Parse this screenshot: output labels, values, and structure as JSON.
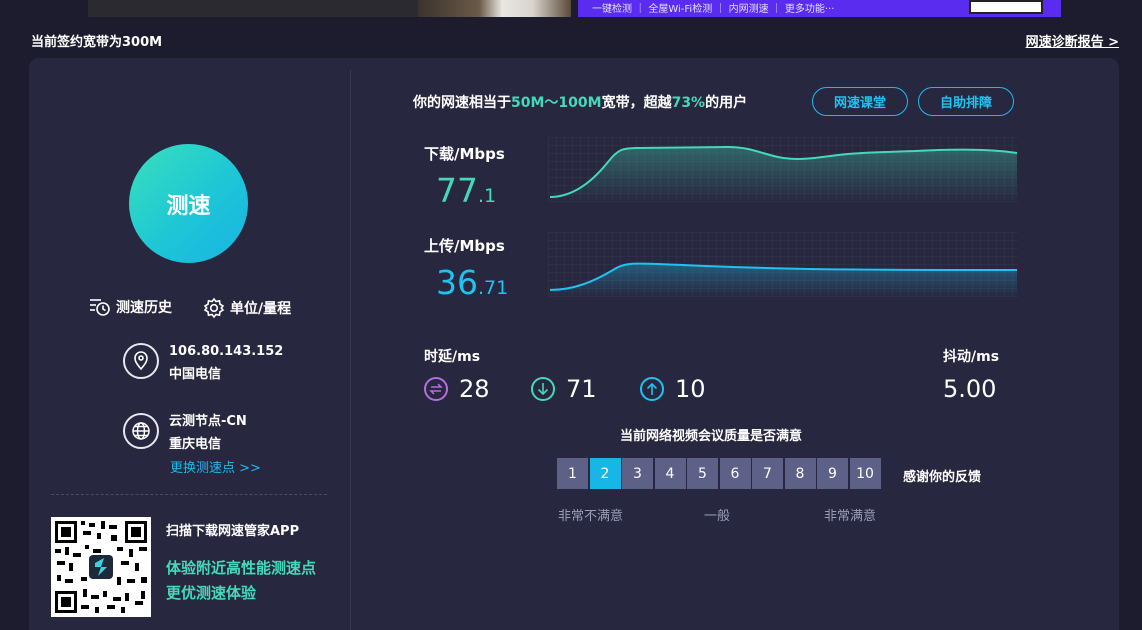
{
  "plan_text": "当前签约宽带为300M",
  "report_link": "网速诊断报告 >",
  "banner_right_text": "一键检测 ｜ 全屋Wi-Fi检测 ｜ 内网测速 ｜ 更多功能···",
  "start_button": "测速",
  "links": {
    "history": "测速历史",
    "units": "单位/量程"
  },
  "client": {
    "ip": "106.80.143.152",
    "isp": "中国电信"
  },
  "server": {
    "name": "云测节点-CN",
    "isp": "重庆电信",
    "change": "更换测速点 >>"
  },
  "app": {
    "title": "扫描下载网速管家APP",
    "line1": "体验附近高性能测速点",
    "line2": "更优测速体验"
  },
  "summary": {
    "prefix": "你的网速相当于",
    "band": "50M～100M",
    "mid": "宽带，超越",
    "percent": "73%",
    "suffix": "的用户"
  },
  "buttons": {
    "classroom": "网速课堂",
    "troubleshoot": "自助排障"
  },
  "download": {
    "label": "下载/Mbps",
    "int": "77",
    "dec": ".1",
    "color": "#44d9b8"
  },
  "upload": {
    "label": "上传/Mbps",
    "int": "36",
    "dec": ".71",
    "color": "#1fc3f0"
  },
  "latency": {
    "label": "时延/ms",
    "idle": "28",
    "down": "71",
    "up": "10",
    "colors": [
      "#b46fe0",
      "#44d9b8",
      "#1fc3f0"
    ]
  },
  "jitter": {
    "label": "抖动/ms",
    "value": "5.00"
  },
  "survey": {
    "question": "当前网络视频会议质量是否满意",
    "options": [
      "1",
      "2",
      "3",
      "4",
      "5",
      "6",
      "7",
      "8",
      "9",
      "10"
    ],
    "selected": "2",
    "thanks": "感谢你的反馈",
    "low": "非常不满意",
    "mid": "一般",
    "high": "非常满意"
  }
}
